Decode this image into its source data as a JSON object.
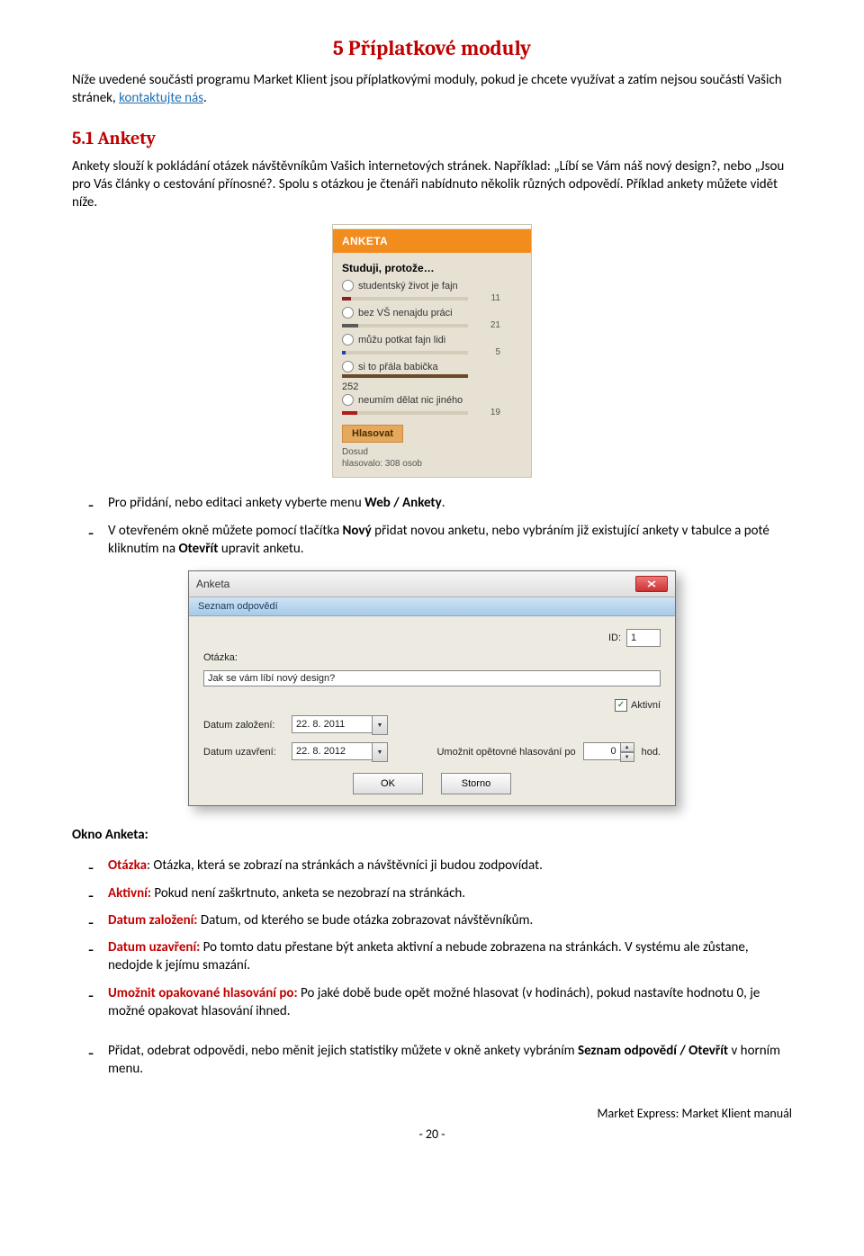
{
  "heading": "5  Příplatkové moduly",
  "intro_a": "Níže uvedené součásti programu Market Klient jsou příplatkovými moduly, pokud je chcete využívat a zatím nejsou součástí Vašich stránek, ",
  "intro_link": "kontaktujte nás",
  "intro_b": ".",
  "h2": "5.1  Ankety",
  "p51": "Ankety slouží k pokládání otázek návštěvníkům Vašich internetových stránek. Například: „Líbí se Vám náš nový design?, nebo „Jsou pro Vás články o cestování přínosné?. Spolu s otázkou je čtenáři nabídnuto několik různých odpovědí. Příklad ankety můžete vidět níže.",
  "poll": {
    "header": "ANKETA",
    "question": "Studuji, protože…",
    "options": [
      {
        "label": "studentský život je fajn",
        "count": "11",
        "color": "#8c1f1f",
        "pct": 7
      },
      {
        "label": "bez VŠ nenajdu práci",
        "count": "21",
        "color": "#5a5a5a",
        "pct": 13
      },
      {
        "label": "můžu potkat fajn lidi",
        "count": "5",
        "color": "#1f3fbf",
        "pct": 3
      },
      {
        "label": "si to přála babička",
        "count": "252",
        "color": "#6b4a2a",
        "pct": 100,
        "count_below": true
      },
      {
        "label": "neumím dělat nic jiného",
        "count": "19",
        "color": "#b01c1c",
        "pct": 12
      }
    ],
    "vote": "Hlasovat",
    "foot1": "Dosud",
    "foot2": "hlasovalo: 308 osob"
  },
  "bullets1": [
    {
      "a": "Pro přidání, nebo editaci ankety vyberte menu ",
      "bold": "Web / Ankety",
      "b": "."
    },
    {
      "a": "V otevřeném okně můžete pomocí tlačítka ",
      "bold": "Nový",
      "b": " přidat novou anketu, nebo vybráním již existující ankety v tabulce a poté kliknutím na ",
      "bold2": "Otevřít",
      "c": " upravit anketu."
    }
  ],
  "dialog": {
    "title": "Anketa",
    "sub": "Seznam odpovědí",
    "id_label": "ID:",
    "id_value": "1",
    "q_label": "Otázka:",
    "q_value": "Jak se vám líbí nový design?",
    "d1_label": "Datum založení:",
    "d1_value": "22. 8. 2011",
    "d2_label": "Datum uzavření:",
    "d2_value": "22. 8. 2012",
    "active_label": "Aktivní",
    "repeat_label": "Umožnit opětovné hlasování po",
    "repeat_value": "0",
    "repeat_unit": "hod.",
    "ok": "OK",
    "cancel": "Storno"
  },
  "okno_heading": "Okno Anketa:",
  "defs": [
    {
      "term": "Otázka",
      "colon": ":  ",
      "body": "Otázka, která se zobrazí na stránkách a návštěvníci ji budou zodpovídat."
    },
    {
      "term": "Aktivní:",
      "colon": " ",
      "body": "Pokud není zaškrtnuto, anketa se nezobrazí na stránkách."
    },
    {
      "term": "Datum založení:",
      "colon": " ",
      "body": "Datum, od kterého se bude otázka zobrazovat návštěvníkům."
    },
    {
      "term": "Datum uzavření:",
      "colon": " ",
      "body": "Po tomto datu přestane být anketa aktivní a nebude zobrazena na stránkách. V systému ale zůstane, nedojde k jejímu smazání."
    },
    {
      "term": "Umožnit opakované hlasování po:",
      "colon": " ",
      "body": "Po jaké době bude opět možné hlasovat (v hodinách), pokud nastavíte hodnotu 0, je možné opakovat hlasování ihned."
    }
  ],
  "last1a": "Přidat, odebrat odpovědi, nebo měnit jejich statistiky můžete v okně ankety vybráním ",
  "last1b": "Seznam odpovědí / Otevřít",
  "last1c": " v horním menu.",
  "footer": "Market Express: Market Klient manuál",
  "pagenum": "- 20 -"
}
